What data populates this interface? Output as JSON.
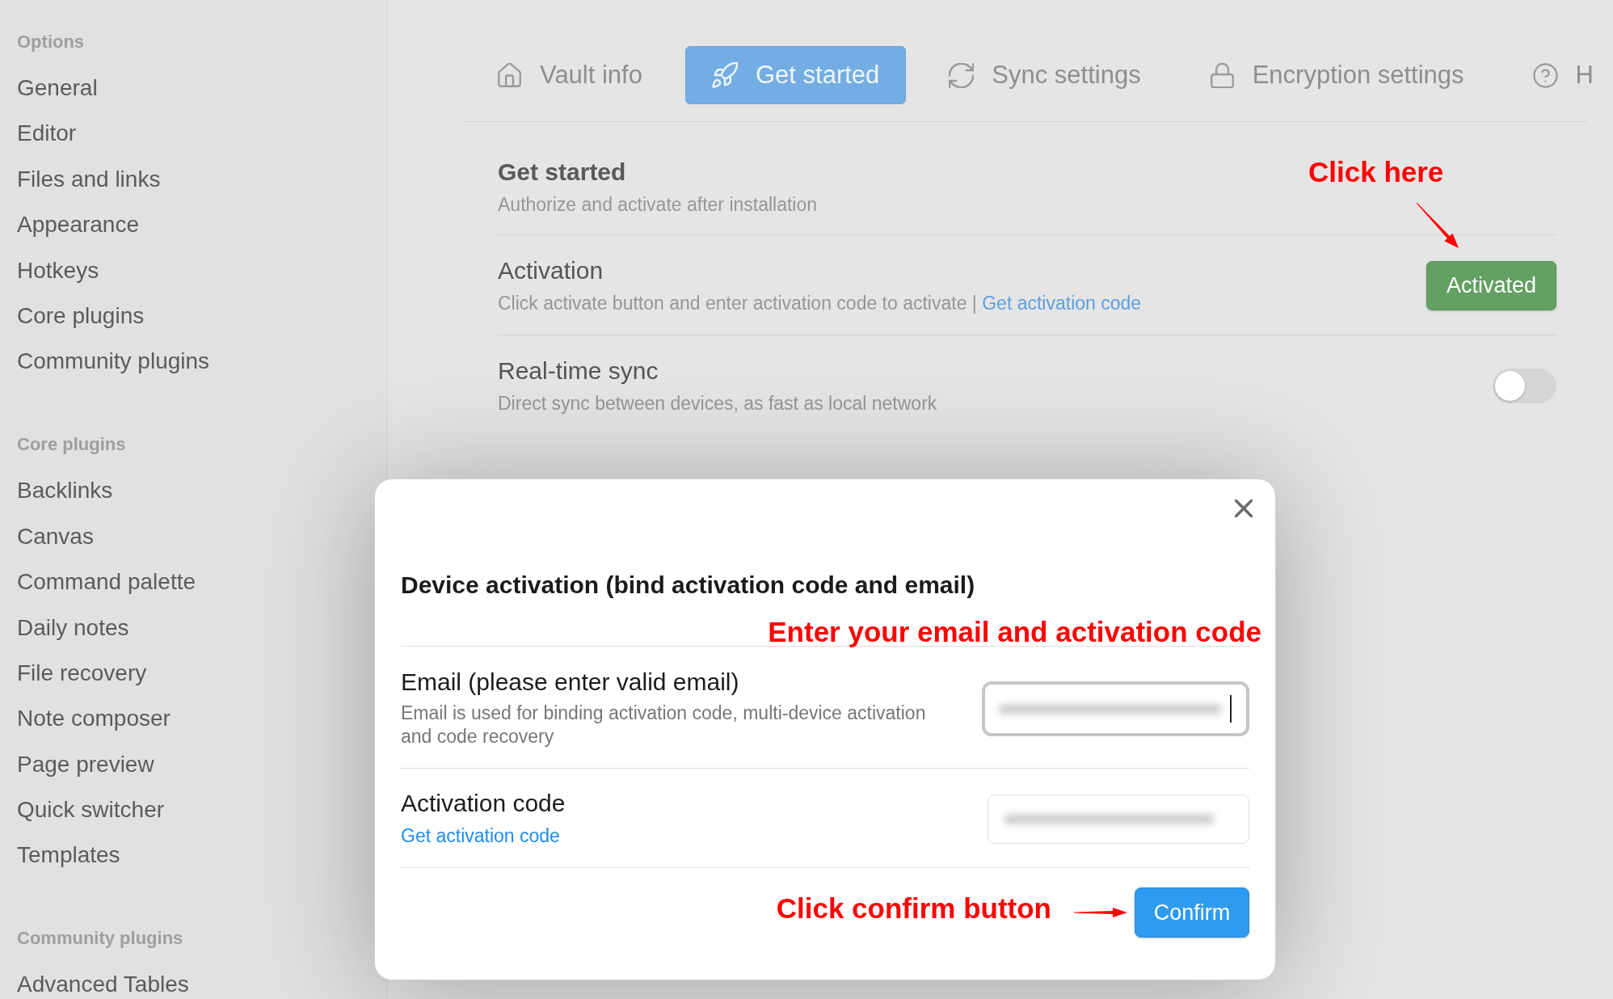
{
  "sidebar": {
    "sections": [
      {
        "heading": "Options",
        "items": [
          {
            "label": "General",
            "selected": false
          },
          {
            "label": "Editor",
            "selected": false
          },
          {
            "label": "Files and links",
            "selected": false
          },
          {
            "label": "Appearance",
            "selected": false
          },
          {
            "label": "Hotkeys",
            "selected": false
          },
          {
            "label": "Core plugins",
            "selected": false
          },
          {
            "label": "Community plugins",
            "selected": false
          }
        ]
      },
      {
        "heading": "Core plugins",
        "items": [
          {
            "label": "Backlinks",
            "selected": false
          },
          {
            "label": "Canvas",
            "selected": false
          },
          {
            "label": "Command palette",
            "selected": false
          },
          {
            "label": "Daily notes",
            "selected": false
          },
          {
            "label": "File recovery",
            "selected": false
          },
          {
            "label": "Note composer",
            "selected": false
          },
          {
            "label": "Page preview",
            "selected": false
          },
          {
            "label": "Quick switcher",
            "selected": false
          },
          {
            "label": "Templates",
            "selected": false
          }
        ]
      },
      {
        "heading": "Community plugins",
        "items": [
          {
            "label": "Advanced Tables",
            "selected": false
          }
        ]
      }
    ]
  },
  "tabs": [
    {
      "label": "Vault info",
      "selected": false
    },
    {
      "label": "Get started",
      "selected": true
    },
    {
      "label": "Sync settings",
      "selected": false
    },
    {
      "label": "Encryption settings",
      "selected": false
    },
    {
      "label": "H",
      "selected": false
    }
  ],
  "settings": {
    "title": "Get started",
    "description": "Authorize and activate after installation",
    "rows": [
      {
        "kind": "button",
        "title": "Activation",
        "description": "Click activate button and enter activation code to activate |",
        "link": "Get activation code",
        "button": "Activated"
      },
      {
        "kind": "toggle",
        "title": "Real-time sync",
        "description": "Direct sync between devices, as fast as local network",
        "on": false
      }
    ]
  },
  "modal": {
    "title": "Device activation (bind activation code and email)",
    "fields": [
      {
        "label": "Email (please enter valid email)",
        "description": "Email is used for binding activation code, multi-device activation and code recovery",
        "focused": true
      },
      {
        "label": "Activation code",
        "link": "Get activation code",
        "focused": false
      }
    ],
    "confirm_button": "Confirm"
  },
  "annotations": {
    "activation_button": "Click here",
    "form": "Enter your email and activation code",
    "confirm_button": "Click confirm button"
  }
}
